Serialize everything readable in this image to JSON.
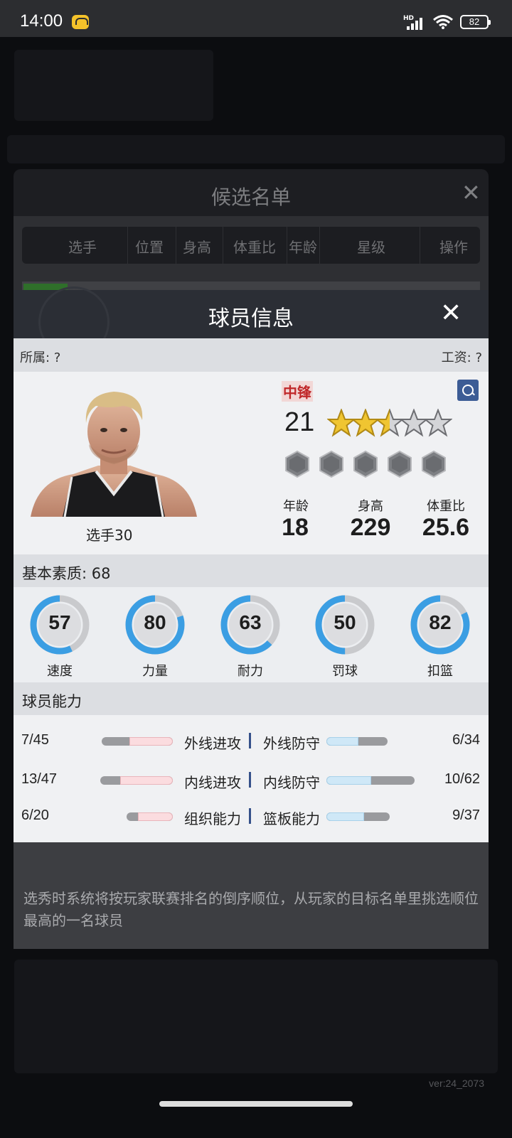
{
  "status_bar": {
    "time": "14:00",
    "network": "HD",
    "battery": "82"
  },
  "candidate_list": {
    "title": "候选名单",
    "columns": [
      "选手",
      "位置",
      "身高",
      "体重比",
      "年龄",
      "星级",
      "操作"
    ]
  },
  "player_info": {
    "title": "球员信息",
    "affiliation": "所属: ?",
    "salary": "工资: ?",
    "position": "中锋",
    "number": "21",
    "stars": 2.5,
    "max_stars": 5,
    "player_name": "选手30",
    "stats": [
      {
        "label": "年龄",
        "value": "18"
      },
      {
        "label": "身高",
        "value": "229"
      },
      {
        "label": "体重比",
        "value": "25.6"
      }
    ],
    "base_quality": "基本素质: 68",
    "attributes": [
      {
        "label": "速度",
        "value": "57",
        "level": 0.57
      },
      {
        "label": "力量",
        "value": "80",
        "level": 0.8
      },
      {
        "label": "耐力",
        "value": "63",
        "level": 0.63
      },
      {
        "label": "罚球",
        "value": "50",
        "level": 0.5
      },
      {
        "label": "扣篮",
        "value": "82",
        "level": 0.82
      }
    ],
    "ability_title": "球员能力",
    "abilities": [
      {
        "left_value": "7/45",
        "left_name": "外线进攻",
        "right_name": "外线防守",
        "right_value": "6/34",
        "left_fill": 0.156,
        "right_fill": 0.176
      },
      {
        "left_value": "13/47",
        "left_name": "内线进攻",
        "right_name": "内线防守",
        "right_value": "10/62",
        "left_fill": 0.277,
        "right_fill": 0.161
      },
      {
        "left_value": "6/20",
        "left_name": "组织能力",
        "right_name": "篮板能力",
        "right_value": "9/37",
        "left_fill": 0.3,
        "right_fill": 0.243
      }
    ]
  },
  "tip": "选秀时系统将按玩家联赛排名的倒序顺位，从玩家的目标名单里挑选顺位最高的一名球员",
  "version": "ver:24_2073",
  "colors": {
    "ring_blue": "#3b9ee3",
    "ring_gray": "#c9cacd",
    "position_red": "#c0282a",
    "star_gold": "#f0c531",
    "divider_blue": "#35518a"
  }
}
